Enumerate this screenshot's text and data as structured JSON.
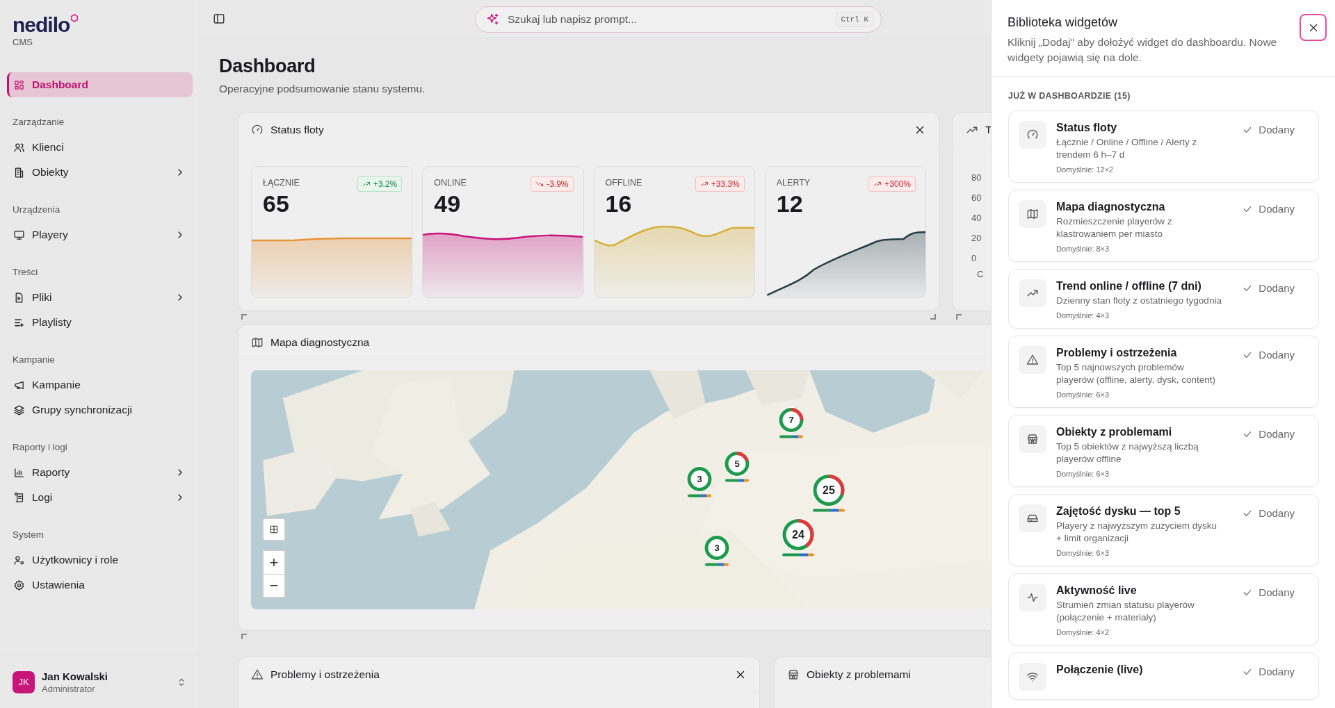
{
  "sidebar": {
    "logo": "nedilo",
    "logo_sub": "CMS",
    "top_items": [
      {
        "label": "Dashboard",
        "selected": true,
        "has_submenu": false
      }
    ],
    "groups": [
      {
        "label": "Zarządzanie",
        "items": [
          {
            "label": "Klienci",
            "selected": false,
            "has_submenu": false
          },
          {
            "label": "Obiekty",
            "selected": false,
            "has_submenu": true
          }
        ]
      },
      {
        "label": "Urządzenia",
        "items": [
          {
            "label": "Playery",
            "selected": false,
            "has_submenu": true
          }
        ]
      },
      {
        "label": "Treści",
        "items": [
          {
            "label": "Pliki",
            "selected": false,
            "has_submenu": true
          },
          {
            "label": "Playlisty",
            "selected": false,
            "has_submenu": false
          }
        ]
      },
      {
        "label": "Kampanie",
        "items": [
          {
            "label": "Kampanie",
            "selected": false,
            "has_submenu": false
          },
          {
            "label": "Grupy synchronizacji",
            "selected": false,
            "has_submenu": false
          }
        ]
      },
      {
        "label": "Raporty i logi",
        "items": [
          {
            "label": "Raporty",
            "selected": false,
            "has_submenu": true
          },
          {
            "label": "Logi",
            "selected": false,
            "has_submenu": true
          }
        ]
      },
      {
        "label": "System",
        "items": [
          {
            "label": "Użytkownicy i role",
            "selected": false,
            "has_submenu": false
          },
          {
            "label": "Ustawienia",
            "selected": false,
            "has_submenu": false
          }
        ]
      }
    ],
    "user": {
      "initials": "JK",
      "name": "Jan Kowalski",
      "role": "Administrator"
    }
  },
  "topbar": {
    "search": {
      "placeholder": "Szukaj lub napisz prompt...",
      "shortcut": "Ctrl K"
    }
  },
  "page": {
    "title": "Dashboard",
    "subtitle": "Operacyjne podsumowanie stanu systemu."
  },
  "status_widget": {
    "title": "Status floty",
    "metrics": [
      {
        "label": "ŁĄCZNIE",
        "value": "65",
        "change": "+3.2%",
        "kind": "up_good",
        "color": "#e8953a"
      },
      {
        "label": "ONLINE",
        "value": "49",
        "change": "-3.9%",
        "kind": "down_bad",
        "color": "#c8157a"
      },
      {
        "label": "OFFLINE",
        "value": "16",
        "change": "+33.3%",
        "kind": "up_bad",
        "color": "#d6b03c"
      },
      {
        "label": "ALERTY",
        "value": "12",
        "change": "+300%",
        "kind": "up_bad",
        "color": "#263c47"
      }
    ]
  },
  "trend_widget": {
    "title": "T",
    "yticks": [
      "80",
      "60",
      "40",
      "20",
      "0"
    ],
    "column_1": "C"
  },
  "map_widget": {
    "title": "Mapa diagnostyczna",
    "clusters": [
      {
        "count": "7"
      },
      {
        "count": "5"
      },
      {
        "count": "3"
      },
      {
        "count": "25"
      },
      {
        "count": "24"
      },
      {
        "count": "3"
      }
    ],
    "zoom_in": "+",
    "zoom_out": "−"
  },
  "bottom_widgets": [
    {
      "title": "Problemy i ostrzeżenia",
      "closable": true
    },
    {
      "title": "Obiekty z problemami"
    }
  ],
  "panel": {
    "title": "Biblioteka widgetów",
    "description": "Kliknij „Dodaj\" aby dołożyć widget do dashboardu. Nowe widgety pojawią się na dole.",
    "section": "JUŻ W DASHBOARDZIE (15)",
    "items": [
      {
        "title": "Status floty",
        "description": "Łącznie / Online / Offline / Alerty z trendem 6 h–7 d",
        "default": "Domyślnie: 12×2",
        "status": "Dodany",
        "added": true
      },
      {
        "title": "Mapa diagnostyczna",
        "description": "Rozmieszczenie playerów z klastrowaniem per miasto",
        "default": "Domyślnie: 8×3",
        "status": "Dodany",
        "added": true
      },
      {
        "title": "Trend online / offline (7 dni)",
        "description": "Dzienny stan floty z ostatniego tygodnia",
        "default": "Domyślnie: 4×3",
        "status": "Dodany",
        "added": true
      },
      {
        "title": "Problemy i ostrzeżenia",
        "description": "Top 5 najnowszych problemów playerów (offline, alerty, dysk, content)",
        "default": "Domyślnie: 6×3",
        "status": "Dodany",
        "added": true
      },
      {
        "title": "Obiekty z problemami",
        "description": "Top 5 obiektów z najwyższą liczbą playerów offline",
        "default": "Domyślnie: 6×3",
        "status": "Dodany",
        "added": true
      },
      {
        "title": "Zajętość dysku — top 5",
        "description": "Playery z najwyższym zużyciem dysku + limit organizacji",
        "default": "Domyślnie: 6×3",
        "status": "Dodany",
        "added": true
      },
      {
        "title": "Aktywność live",
        "description": "Strumień zmian statusu playerów (połączenie + materiały)",
        "default": "Domyślnie: 4×2",
        "status": "Dodany",
        "added": true
      },
      {
        "title": "Połączenie (live)",
        "status": "Dodany",
        "added": true
      }
    ]
  }
}
